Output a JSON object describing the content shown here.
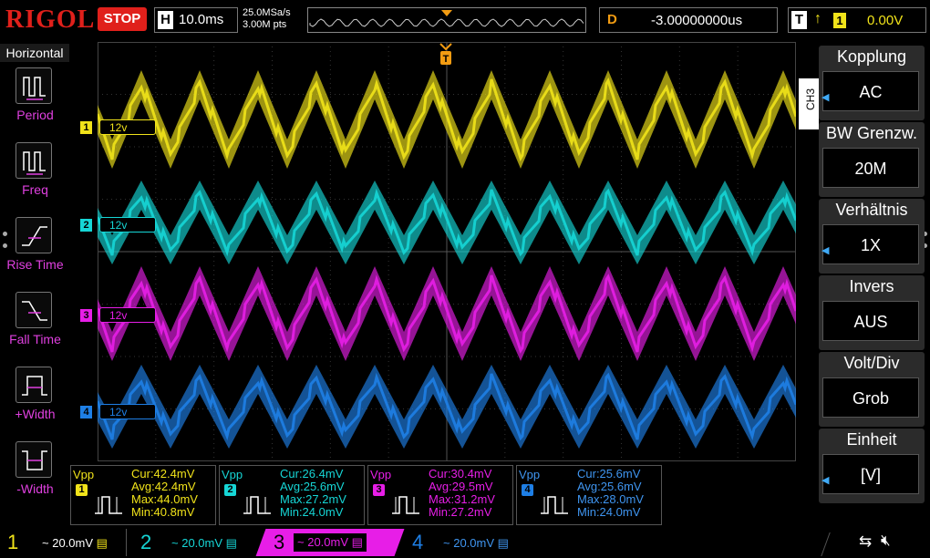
{
  "top": {
    "logo": "RIGOL",
    "status": "STOP",
    "h_label": "H",
    "h_value": "10.0ms",
    "sample_rate": "25.0MSa/s",
    "points": "3.00M pts",
    "d_label": "D",
    "d_value": "-3.00000000us",
    "t_label": "T",
    "t_source": "1",
    "t_level": "0.00V",
    "trigger_marker": "T"
  },
  "left": {
    "title": "Horizontal",
    "items": [
      {
        "label": "Period",
        "icon": "period-icon"
      },
      {
        "label": "Freq",
        "icon": "freq-icon"
      },
      {
        "label": "Rise Time",
        "icon": "rise-time-icon"
      },
      {
        "label": "Fall Time",
        "icon": "fall-time-icon"
      },
      {
        "label": "+Width",
        "icon": "plus-width-icon"
      },
      {
        "label": "-Width",
        "icon": "minus-width-icon"
      }
    ]
  },
  "channels": [
    {
      "num": "1",
      "tag": "12v",
      "color": "#f1e31a",
      "scale": "20.0mV"
    },
    {
      "num": "2",
      "tag": "12v",
      "color": "#16d6d6",
      "scale": "20.0mV"
    },
    {
      "num": "3",
      "tag": "12v",
      "color": "#e71ee7",
      "scale": "20.0mV"
    },
    {
      "num": "4",
      "tag": "12v",
      "color": "#1e7fe6",
      "scale": "20.0mV"
    }
  ],
  "right": {
    "channel_tab": "CH3",
    "menus": [
      {
        "title": "Kopplung",
        "value": "AC"
      },
      {
        "title": "BW Grenzw.",
        "value": "20M"
      },
      {
        "title": "Verhältnis",
        "value": "1X"
      },
      {
        "title": "Invers",
        "value": "AUS"
      },
      {
        "title": "Volt/Div",
        "value": "Grob"
      },
      {
        "title": "Einheit",
        "value": "[V]"
      }
    ]
  },
  "measurements": [
    {
      "label": "Vpp",
      "ch": "1",
      "cur": "Cur:42.4mV",
      "avg": "Avg:42.4mV",
      "max": "Max:44.0mV",
      "min": "Min:40.8mV"
    },
    {
      "label": "Vpp",
      "ch": "2",
      "cur": "Cur:26.4mV",
      "avg": "Avg:25.6mV",
      "max": "Max:27.2mV",
      "min": "Min:24.0mV"
    },
    {
      "label": "Vpp",
      "ch": "3",
      "cur": "Cur:30.4mV",
      "avg": "Avg:29.5mV",
      "max": "Max:31.2mV",
      "min": "Min:27.2mV"
    },
    {
      "label": "Vpp",
      "ch": "4",
      "cur": "Cur:25.6mV",
      "avg": "Avg:25.6mV",
      "max": "Max:28.0mV",
      "min": "Min:24.0mV"
    }
  ],
  "bottom": {
    "coupling_symbol": "~"
  }
}
